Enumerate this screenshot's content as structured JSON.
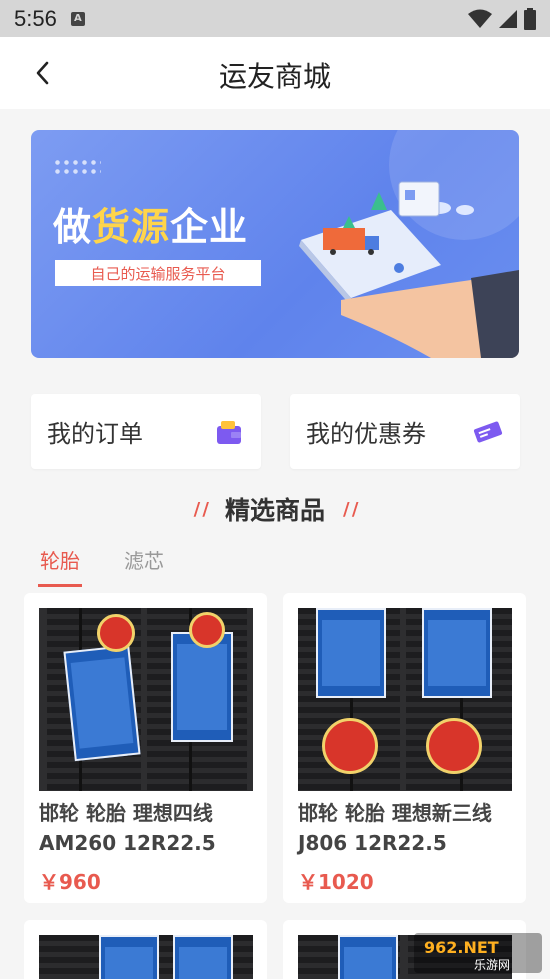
{
  "status_bar": {
    "time": "5:56",
    "badge": "A"
  },
  "nav": {
    "title": "运友商城"
  },
  "banner": {
    "headline_part1": "做",
    "headline_part2": "货源",
    "headline_part3": "企业",
    "subtitle": "自己的运输服务平台"
  },
  "quick_links": [
    {
      "label": "我的订单",
      "icon": "wallet-icon"
    },
    {
      "label": "我的优惠券",
      "icon": "ticket-icon"
    }
  ],
  "section": {
    "title": "精选商品"
  },
  "tabs": [
    {
      "label": "轮胎",
      "active": true
    },
    {
      "label": "滤芯",
      "active": false
    }
  ],
  "products": [
    {
      "name": "邯轮 轮胎 理想四线AM260 12R22.5",
      "price": "￥960"
    },
    {
      "name": "邯轮 轮胎 理想新三线J806 12R22.5",
      "price": "￥1020"
    }
  ],
  "watermark": {
    "line1": "962.NET",
    "line2": "乐游网"
  },
  "colors": {
    "accent": "#e85a4f",
    "banner_blue": "#6a8ff0",
    "highlight_yellow": "#ffd54a"
  }
}
